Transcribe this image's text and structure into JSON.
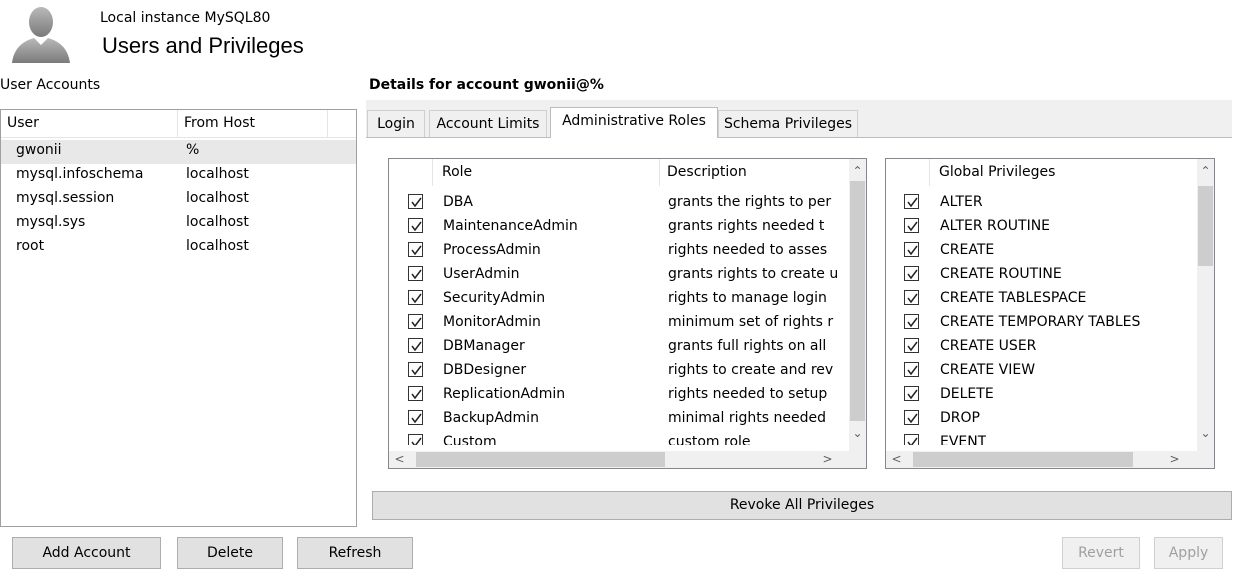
{
  "header": {
    "instance": "Local instance MySQL80",
    "title": "Users and Privileges"
  },
  "accounts": {
    "label": "User Accounts",
    "columns": [
      "User",
      "From Host"
    ],
    "rows": [
      {
        "user": "gwonii",
        "host": "%"
      },
      {
        "user": "mysql.infoschema",
        "host": "localhost"
      },
      {
        "user": "mysql.session",
        "host": "localhost"
      },
      {
        "user": "mysql.sys",
        "host": "localhost"
      },
      {
        "user": "root",
        "host": "localhost"
      }
    ]
  },
  "details": {
    "label": "Details for account gwonii@%",
    "tabs": [
      "Login",
      "Account Limits",
      "Administrative Roles",
      "Schema Privileges"
    ],
    "roles_table": {
      "columns": [
        "Role",
        "Description"
      ],
      "rows": [
        {
          "role": "DBA",
          "desc": "grants the rights to per"
        },
        {
          "role": "MaintenanceAdmin",
          "desc": "grants rights needed t"
        },
        {
          "role": "ProcessAdmin",
          "desc": "rights needed to asses"
        },
        {
          "role": "UserAdmin",
          "desc": "grants rights to create u"
        },
        {
          "role": "SecurityAdmin",
          "desc": "rights to manage login"
        },
        {
          "role": "MonitorAdmin",
          "desc": "minimum set of rights r"
        },
        {
          "role": "DBManager",
          "desc": "grants full rights on all"
        },
        {
          "role": "DBDesigner",
          "desc": "rights to create and rev"
        },
        {
          "role": "ReplicationAdmin",
          "desc": "rights needed to setup"
        },
        {
          "role": "BackupAdmin",
          "desc": "minimal rights needed"
        },
        {
          "role": "Custom",
          "desc": "custom role"
        }
      ]
    },
    "privileges_table": {
      "column": "Global Privileges",
      "rows": [
        "ALTER",
        "ALTER ROUTINE",
        "CREATE",
        "CREATE ROUTINE",
        "CREATE TABLESPACE",
        "CREATE TEMPORARY TABLES",
        "CREATE USER",
        "CREATE VIEW",
        "DELETE",
        "DROP",
        "EVENT"
      ]
    },
    "revoke_button": "Revoke All Privileges"
  },
  "buttons": {
    "add": "Add Account",
    "delete": "Delete",
    "refresh": "Refresh",
    "revert": "Revert",
    "apply": "Apply"
  }
}
